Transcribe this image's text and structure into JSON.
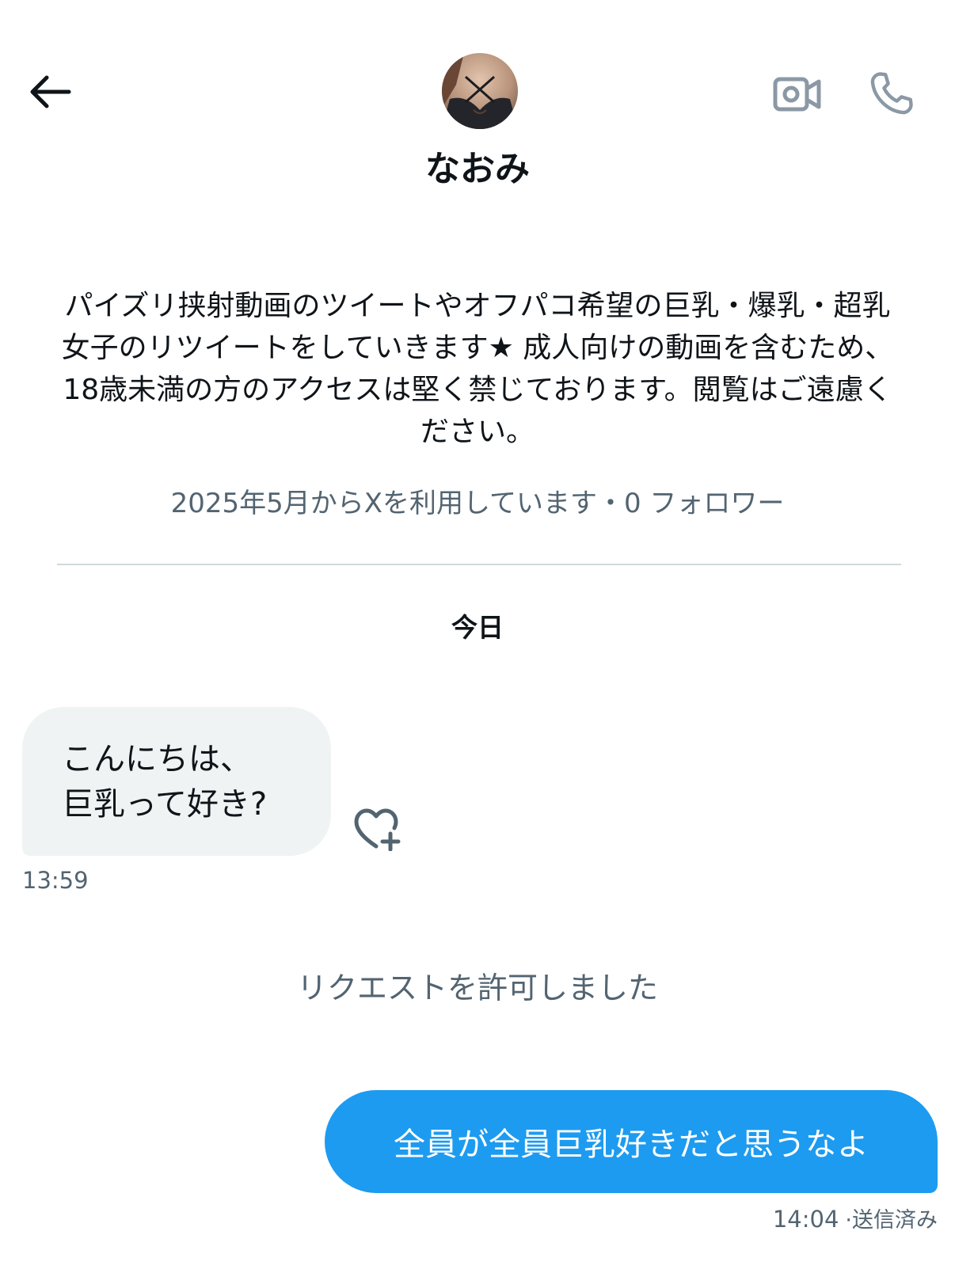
{
  "header": {
    "name": "なおみ",
    "back_icon": "arrow-left-icon",
    "video_icon": "video-camera-icon",
    "phone_icon": "phone-icon"
  },
  "profile": {
    "bio": "パイズリ挟射動画のツイートやオフパコ希望の巨乳・爆乳・超乳女子のリツイートをしていきます★ 成人向けの動画を含むため、 18歳未満の方のアクセスは堅く禁じております。閲覧はご遠慮ください。",
    "meta": "2025年5月からXを利用しています・0 フォロワー"
  },
  "conversation": {
    "date_label": "今日",
    "incoming": {
      "text": "こんにちは、\n巨乳って好き?",
      "time": "13:59",
      "reaction_icon": "heart-plus-icon"
    },
    "system_message": "リクエストを許可しました",
    "outgoing": {
      "text": "全員が全員巨乳好きだと思うなよ",
      "time": "14:04",
      "status": "·送信済み"
    }
  },
  "colors": {
    "accent": "#1d9bf0",
    "incoming_bubble": "#eff3f4",
    "secondary_text": "#536471",
    "primary_text": "#0f1419",
    "divider": "#cfd9de"
  }
}
